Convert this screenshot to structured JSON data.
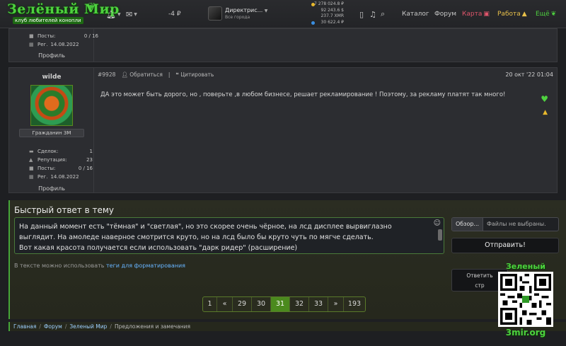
{
  "header": {
    "logo_title": "Зелёный Мир",
    "logo_subtitle": "клуб любителей конопли",
    "balance_label": "-4 ₽",
    "user": {
      "name": "Директрис...",
      "subtitle": "Все города"
    },
    "balances": [
      "7 278 024.8 ₽",
      "92 243.6 $",
      "237.7 XMR",
      "30 622.4 ₽"
    ],
    "nav": [
      {
        "label": "Каталог",
        "color": "#c8c8c8"
      },
      {
        "label": "Форум",
        "color": "#c8c8c8"
      },
      {
        "label": "Карта",
        "color": "#e0556b"
      },
      {
        "label": "Работа",
        "color": "#e8c04a"
      },
      {
        "label": "Ещё",
        "color": "#4ed13f"
      }
    ]
  },
  "prev_post": {
    "stats": [
      {
        "icon": "list-icon",
        "label": "Посты:",
        "value": "0 / 16"
      },
      {
        "icon": "calendar-icon",
        "label": "Рег.",
        "value": "14.08.2022"
      }
    ],
    "profile": "Профиль"
  },
  "post": {
    "username": "wilde",
    "rank": "Гражданин ЗМ",
    "number": "#9928",
    "action_contact": "Обратиться",
    "action_quote": "Цитировать",
    "date": "20 окт '22 01:04",
    "text": "ДА это может быть дорого, но , поверьте ,в любом бизнесе, решает рекламирование ! Поэтому, за рекламу платят так много!",
    "stats": [
      {
        "label": "Сделок:",
        "value": "1"
      },
      {
        "label": "Репутация:",
        "value": "23"
      },
      {
        "label": "Посты:",
        "value": "0 / 16"
      },
      {
        "label": "Рег.",
        "value": "14.08.2022"
      }
    ],
    "profile": "Профиль"
  },
  "quick_reply": {
    "title": "Быстрый ответ в тему",
    "editor_lines": [
      "На данный момент есть \"тёмная\" и \"светлая\", но это скорее очень чёрное, на лсд дисплее вырвиглазно",
      "выглядит. На амоледе наверное смотрится круто, но на лсд было бы круто чуть по мягче сделать.",
      "Вот какая красота получается если использовать \"дарк ридер\" (расширение)"
    ],
    "hint_prefix": "В тексте можно использовать ",
    "hint_link": "теги для форматирования",
    "browse_label": "Обзор...",
    "no_files": "Файлы не выбраны.",
    "send_label": "Отправить!",
    "more_label_1": "Ответить",
    "more_label_2": "стр"
  },
  "pagination": {
    "pages": [
      "1",
      "«",
      "29",
      "30",
      "31",
      "32",
      "33",
      "»",
      "193"
    ],
    "active": "31"
  },
  "breadcrumbs": [
    "Главная",
    "Форум",
    "Зеленый Мир",
    "Предложения и замечания"
  ],
  "watermark": {
    "title": "Зеленый Мир",
    "url": "3mir.org"
  }
}
